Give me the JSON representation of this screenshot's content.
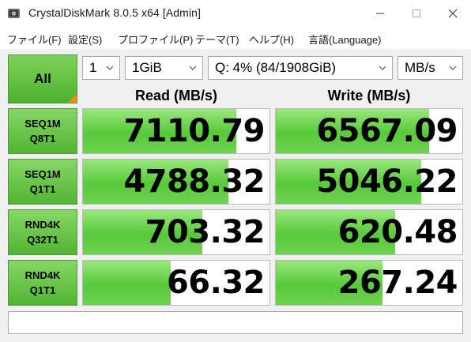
{
  "window": {
    "title": "CrystalDiskMark 8.0.5 x64 [Admin]"
  },
  "menu": [
    "ファイル(F)",
    "設定(S)",
    "プロファイル(P)",
    "テーマ(T)",
    "ヘルプ(H)",
    "言語(Language)"
  ],
  "controls": {
    "all_label": "All",
    "count": "1",
    "size": "1GiB",
    "drive": "Q: 4% (84/1908GiB)",
    "unit": "MB/s"
  },
  "headers": {
    "read": "Read (MB/s)",
    "write": "Write (MB/s)"
  },
  "tests": [
    {
      "line1": "SEQ1M",
      "line2": "Q8T1",
      "read": "7110.79",
      "write": "6567.09",
      "read_fill": 0.82,
      "write_fill": 0.82
    },
    {
      "line1": "SEQ1M",
      "line2": "Q1T1",
      "read": "4788.32",
      "write": "5046.22",
      "read_fill": 0.78,
      "write_fill": 0.78
    },
    {
      "line1": "RND4K",
      "line2": "Q32T1",
      "read": "703.32",
      "write": "620.48",
      "read_fill": 0.64,
      "write_fill": 0.64
    },
    {
      "line1": "RND4K",
      "line2": "Q1T1",
      "read": "66.32",
      "write": "267.24",
      "read_fill": 0.47,
      "write_fill": 0.57
    }
  ],
  "status_text": "",
  "colors": {
    "accent_green": "#52b434",
    "bar_green": "#57c93a",
    "corner_orange": "#ff8a00"
  }
}
